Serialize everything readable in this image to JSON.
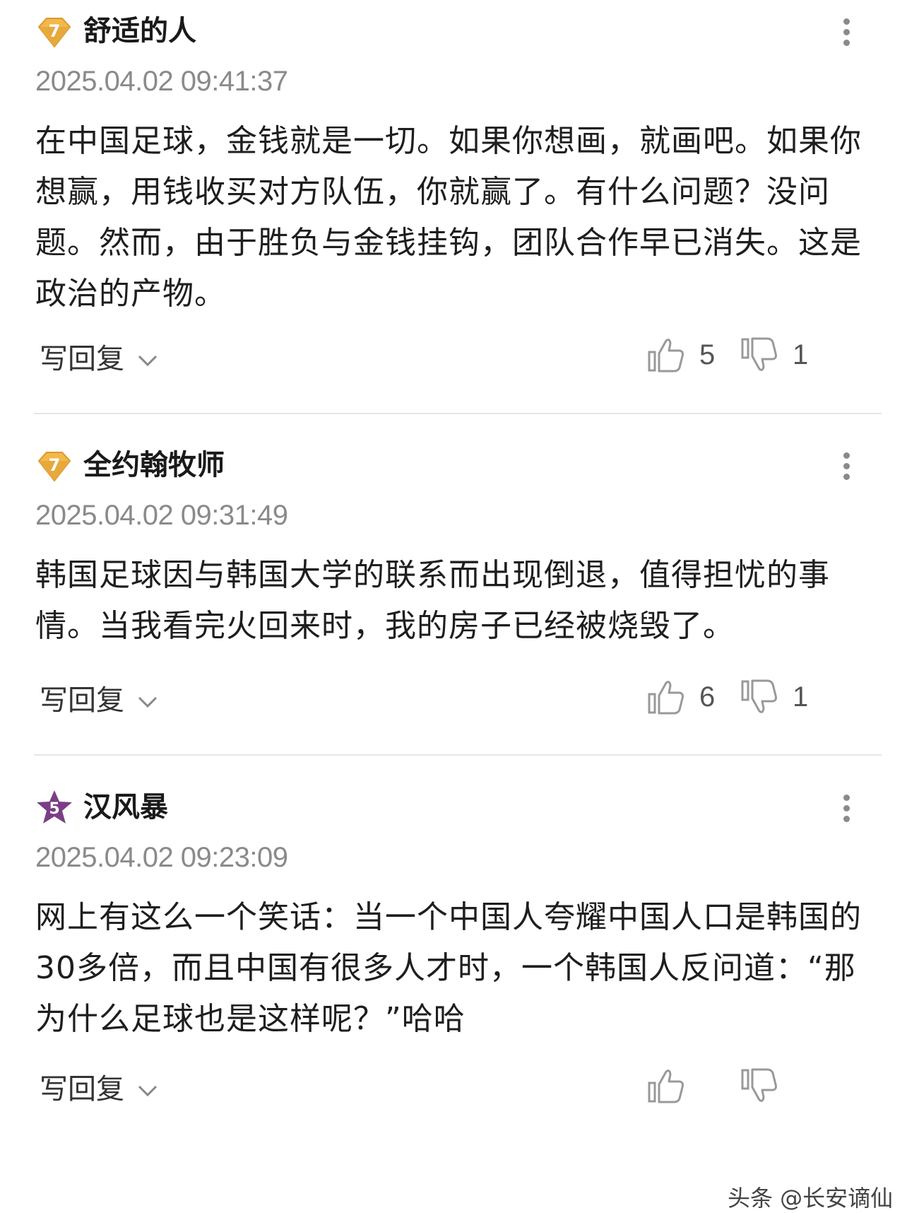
{
  "comments": [
    {
      "level": "7",
      "username": "舒适的人",
      "timestamp": "2025.04.02 09:41:37",
      "text": "在中国足球，金钱就是一切。如果你想画，就画吧。如果你想赢，用钱收买对方队伍，你就赢了。有什么问题？没问题。然而，由于胜负与金钱挂钩，团队合作早已消失。这是政治的产物。",
      "reply_label": "写回复",
      "likes": "5",
      "dislikes": "1"
    },
    {
      "level": "7",
      "username": "全约翰牧师",
      "timestamp": "2025.04.02 09:31:49",
      "text": "韩国足球因与韩国大学的联系而出现倒退，值得担忧的事情。当我看完火回来时，我的房子已经被烧毁了。",
      "reply_label": "写回复",
      "likes": "6",
      "dislikes": "1"
    },
    {
      "level": "5",
      "username": "汉风暴",
      "timestamp": "2025.04.02 09:23:09",
      "text": "网上有这么一个笑话：当一个中国人夸耀中国人口是韩国的30多倍，而且中国有很多人才时，一个韩国人反问道：“那为什么足球也是这样呢？”哈哈",
      "reply_label": "写回复"
    }
  ],
  "watermark": "头条 @长安谪仙",
  "colors": {
    "gold_badge": "#E8A93C",
    "purple_badge": "#7A3E86",
    "meta_gray": "#8a8a8a",
    "divider": "#e6e6e6"
  }
}
